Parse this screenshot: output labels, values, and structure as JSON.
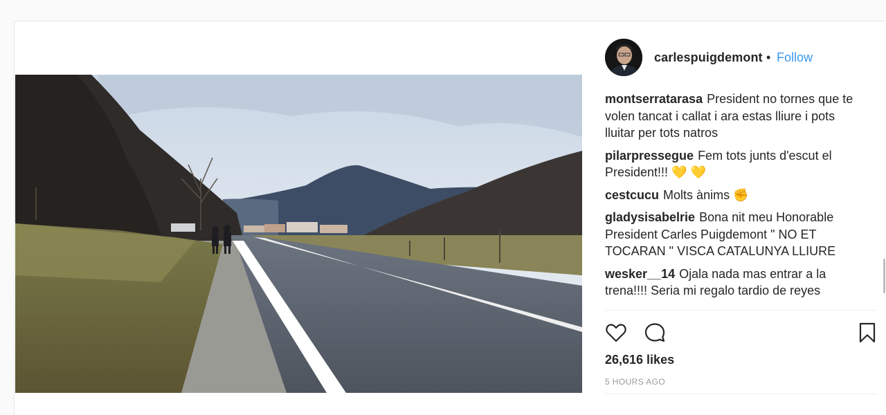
{
  "post": {
    "username": "carlespuigdemont",
    "separator": "•",
    "follow_label": "Follow",
    "likes": "26,616 likes",
    "timestamp": "5 HOURS AGO"
  },
  "comments": [
    {
      "user": "montserratarasa",
      "text": "President no tornes que te volen tancat i callat i ara estas lliure i pots lluitar per tots natros"
    },
    {
      "user": "pilarpressegue",
      "text": "Fem tots junts d'escut el President!!! 💛 💛"
    },
    {
      "user": "cestcucu",
      "text": "Molts ànims ✊"
    },
    {
      "user": "gladysisabelrie",
      "text": "Bona nit meu Honorable President Carles Puigdemont \" NO ET TOCARAN \" VISCA CATALUNYA LLIURE"
    },
    {
      "user": "wesker__14",
      "text": "Ojala nada mas entrar a la trena!!!! Seria mi regalo tardio de reyes"
    }
  ],
  "icons": {
    "like": "heart-icon",
    "comment": "comment-icon",
    "save": "bookmark-icon"
  }
}
